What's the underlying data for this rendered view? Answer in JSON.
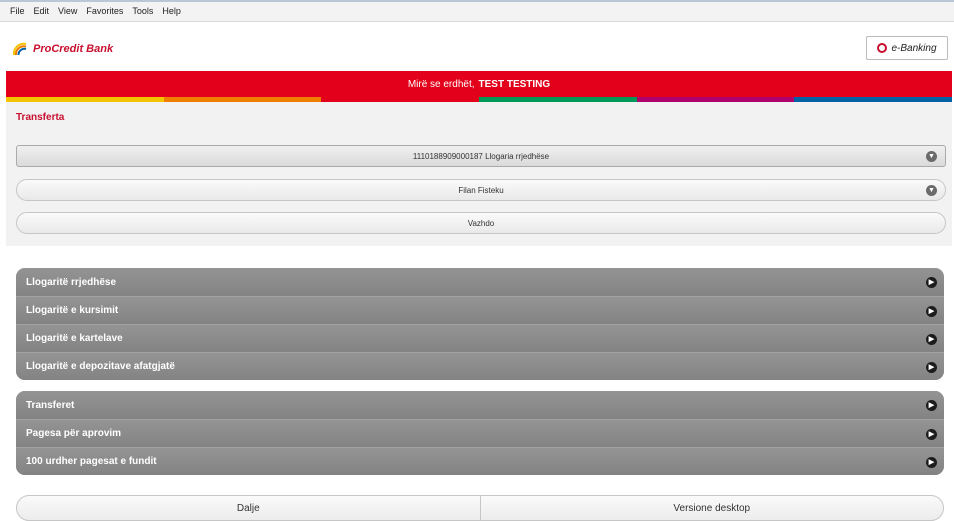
{
  "menubar": {
    "items": [
      "File",
      "Edit",
      "View",
      "Favorites",
      "Tools",
      "Help"
    ]
  },
  "header": {
    "bank_name": "ProCredit Bank",
    "ebanking_label": "e-Banking"
  },
  "welcome": {
    "greeting": "Mirë se erdhët,",
    "user": "TEST TESTING"
  },
  "stripe_colors": [
    "#f5c400",
    "#ee7d00",
    "#e2001a",
    "#00995a",
    "#b0006b",
    "#0063a6"
  ],
  "transfer": {
    "title": "Transferta",
    "account_select": "1110188909000187 Llogaria rrjedhëse",
    "recipient_select": "Filan Fisteku",
    "continue_label": "Vazhdo"
  },
  "accounts_group": {
    "items": [
      "Llogaritë rrjedhëse",
      "Llogaritë e kursimit",
      "Llogaritë e kartelave",
      "Llogaritë e depozitave afatgjatë"
    ]
  },
  "payments_group": {
    "items": [
      "Transferet",
      "Pagesa për aprovim",
      "100 urdher pagesat e fundit"
    ]
  },
  "footer": {
    "logout_label": "Dalje",
    "desktop_label": "Versione desktop"
  },
  "colors": {
    "brand_red": "#e2001a",
    "menu_gray": "#8a8a8a"
  }
}
